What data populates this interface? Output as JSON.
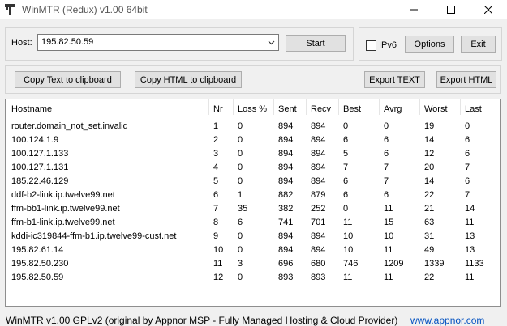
{
  "window": {
    "title": "WinMTR (Redux) v1.00 64bit"
  },
  "host": {
    "label": "Host:",
    "value": "195.82.50.59"
  },
  "buttons": {
    "start": "Start",
    "options": "Options",
    "exit": "Exit",
    "copy_text": "Copy Text to clipboard",
    "copy_html": "Copy HTML to clipboard",
    "export_text": "Export TEXT",
    "export_html": "Export HTML"
  },
  "ipv6": {
    "label": "IPv6",
    "checked": false
  },
  "table": {
    "headers": [
      "Hostname",
      "Nr",
      "Loss %",
      "Sent",
      "Recv",
      "Best",
      "Avrg",
      "Worst",
      "Last"
    ],
    "rows": [
      [
        "router.domain_not_set.invalid",
        "1",
        "0",
        "894",
        "894",
        "0",
        "0",
        "19",
        "0"
      ],
      [
        "100.124.1.9",
        "2",
        "0",
        "894",
        "894",
        "6",
        "6",
        "14",
        "6"
      ],
      [
        "100.127.1.133",
        "3",
        "0",
        "894",
        "894",
        "5",
        "6",
        "12",
        "6"
      ],
      [
        "100.127.1.131",
        "4",
        "0",
        "894",
        "894",
        "7",
        "7",
        "20",
        "7"
      ],
      [
        "185.22.46.129",
        "5",
        "0",
        "894",
        "894",
        "6",
        "7",
        "14",
        "6"
      ],
      [
        "ddf-b2-link.ip.twelve99.net",
        "6",
        "1",
        "882",
        "879",
        "6",
        "6",
        "22",
        "7"
      ],
      [
        "ffm-bb1-link.ip.twelve99.net",
        "7",
        "35",
        "382",
        "252",
        "0",
        "11",
        "21",
        "14"
      ],
      [
        "ffm-b1-link.ip.twelve99.net",
        "8",
        "6",
        "741",
        "701",
        "11",
        "15",
        "63",
        "11"
      ],
      [
        "kddi-ic319844-ffm-b1.ip.twelve99-cust.net",
        "9",
        "0",
        "894",
        "894",
        "10",
        "10",
        "31",
        "13"
      ],
      [
        "195.82.61.14",
        "10",
        "0",
        "894",
        "894",
        "10",
        "11",
        "49",
        "13"
      ],
      [
        "195.82.50.230",
        "11",
        "3",
        "696",
        "680",
        "746",
        "1209",
        "1339",
        "1133"
      ],
      [
        "195.82.50.59",
        "12",
        "0",
        "893",
        "893",
        "11",
        "11",
        "22",
        "11"
      ]
    ]
  },
  "status": {
    "text": "WinMTR v1.00 GPLv2 (original by Appnor MSP - Fully Managed Hosting & Cloud Provider)",
    "link": "www.appnor.com"
  }
}
